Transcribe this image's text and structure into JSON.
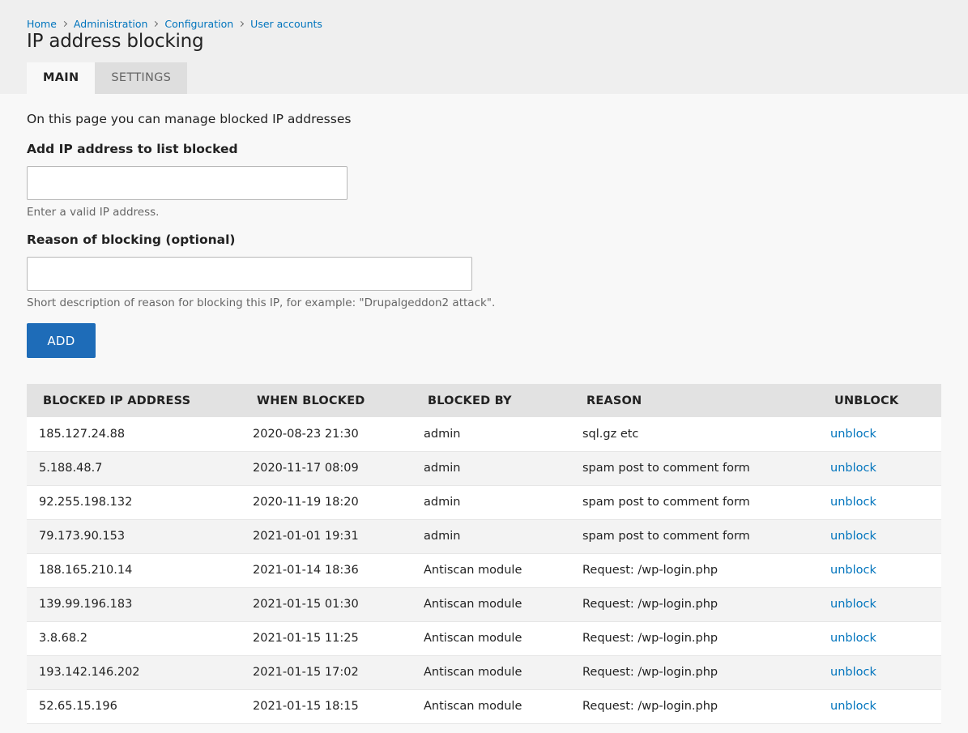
{
  "breadcrumb": [
    {
      "label": "Home"
    },
    {
      "label": "Administration"
    },
    {
      "label": "Configuration"
    },
    {
      "label": "User accounts"
    }
  ],
  "page_title": "IP address blocking",
  "tabs": [
    {
      "label": "Main",
      "active": true
    },
    {
      "label": "Settings",
      "active": false
    }
  ],
  "intro": "On this page you can manage blocked IP addresses",
  "ip_field": {
    "label": "Add IP address to list blocked",
    "value": "",
    "description": "Enter a valid IP address."
  },
  "reason_field": {
    "label": "Reason of blocking (optional)",
    "value": "",
    "description": "Short description of reason for blocking this IP, for example: \"Drupalgeddon2 attack\"."
  },
  "add_button": "Add",
  "table": {
    "columns": [
      "Blocked IP address",
      "When blocked",
      "Blocked by",
      "Reason",
      "Unblock"
    ],
    "rows": [
      {
        "ip": "185.127.24.88",
        "when": "2020-08-23 21:30",
        "by": "admin",
        "reason": "sql.gz etc",
        "action": "unblock"
      },
      {
        "ip": "5.188.48.7",
        "when": "2020-11-17 08:09",
        "by": "admin",
        "reason": "spam post to comment form",
        "action": "unblock"
      },
      {
        "ip": "92.255.198.132",
        "when": "2020-11-19 18:20",
        "by": "admin",
        "reason": "spam post to comment form",
        "action": "unblock"
      },
      {
        "ip": "79.173.90.153",
        "when": "2021-01-01 19:31",
        "by": "admin",
        "reason": "spam post to comment form",
        "action": "unblock"
      },
      {
        "ip": "188.165.210.14",
        "when": "2021-01-14 18:36",
        "by": "Antiscan module",
        "reason": "Request: /wp-login.php",
        "action": "unblock"
      },
      {
        "ip": "139.99.196.183",
        "when": "2021-01-15 01:30",
        "by": "Antiscan module",
        "reason": "Request: /wp-login.php",
        "action": "unblock"
      },
      {
        "ip": "3.8.68.2",
        "when": "2021-01-15 11:25",
        "by": "Antiscan module",
        "reason": "Request: /wp-login.php",
        "action": "unblock"
      },
      {
        "ip": "193.142.146.202",
        "when": "2021-01-15 17:02",
        "by": "Antiscan module",
        "reason": "Request: /wp-login.php",
        "action": "unblock"
      },
      {
        "ip": "52.65.15.196",
        "when": "2021-01-15 18:15",
        "by": "Antiscan module",
        "reason": "Request: /wp-login.php",
        "action": "unblock"
      }
    ]
  },
  "colors": {
    "link": "#0074bd",
    "primary_button": "#1e6cb8",
    "header_bg": "#efefef"
  }
}
